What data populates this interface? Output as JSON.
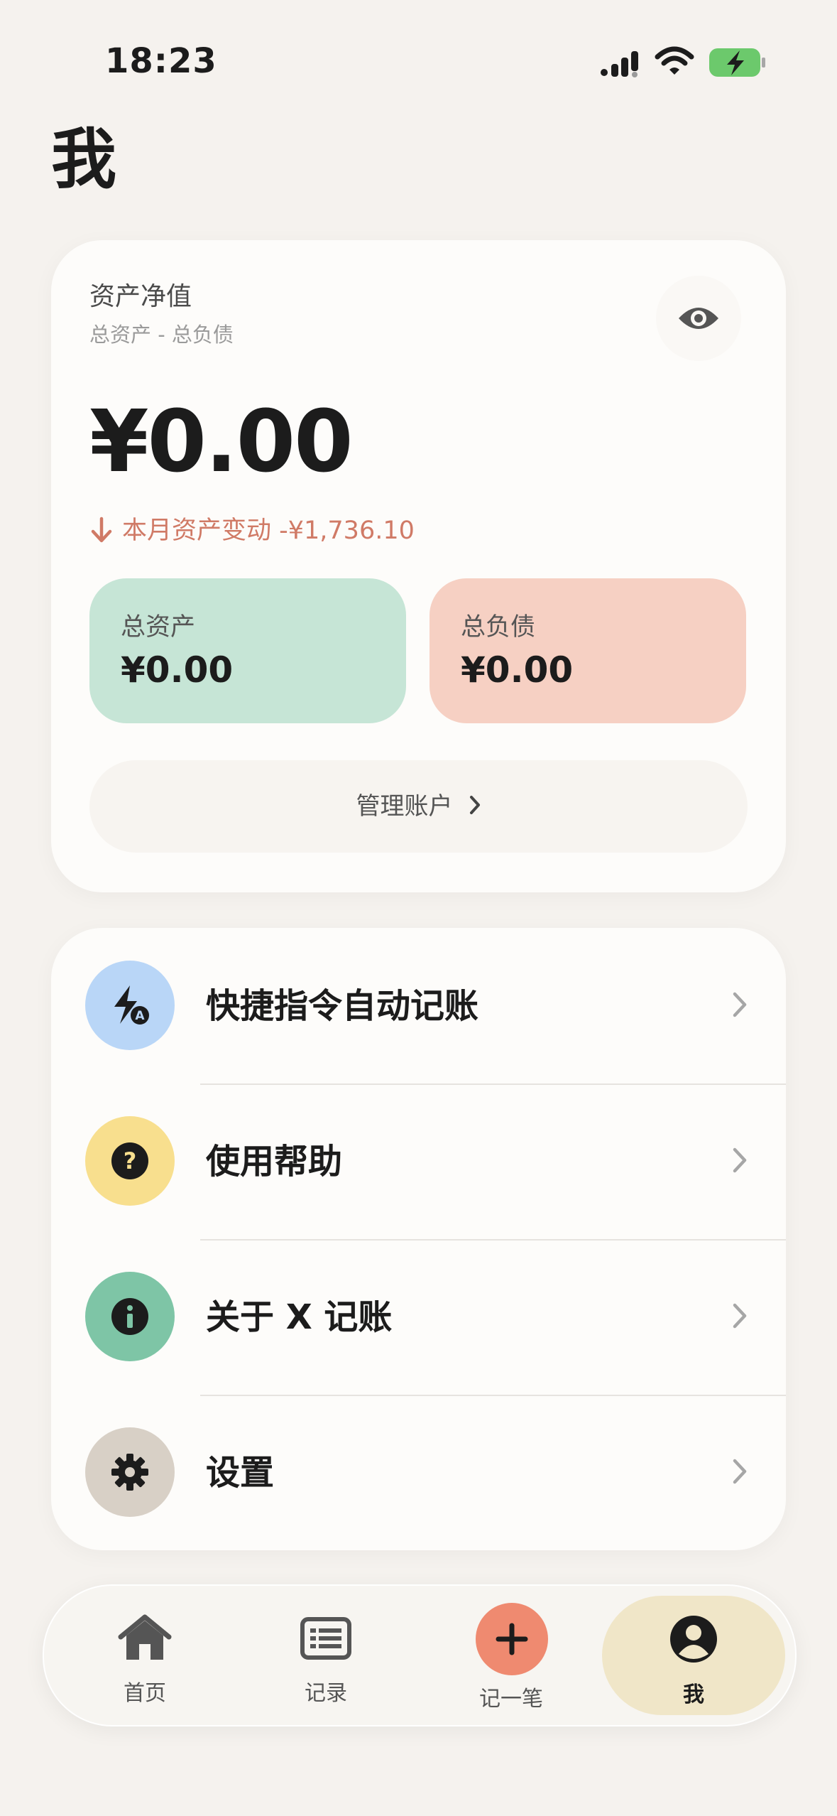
{
  "status_bar": {
    "time": "18:23"
  },
  "page": {
    "title": "我"
  },
  "net_worth": {
    "label": "资产净值",
    "sublabel": "总资产 - 总负债",
    "amount": "¥0.00",
    "change_text": "本月资产变动 -¥1,736.10",
    "assets": {
      "label": "总资产",
      "value": "¥0.00"
    },
    "liabilities": {
      "label": "总负债",
      "value": "¥0.00"
    },
    "manage_label": "管理账户"
  },
  "menu": {
    "items": [
      {
        "label": "快捷指令自动记账",
        "icon": "shortcut-bolt-icon",
        "color": "#b9d6f7"
      },
      {
        "label": "使用帮助",
        "icon": "help-icon",
        "color": "#f8df8e"
      },
      {
        "label": "关于 X 记账",
        "icon": "info-icon",
        "color": "#7ec5a6"
      },
      {
        "label": "设置",
        "icon": "gear-icon",
        "color": "#d8d0c6"
      }
    ]
  },
  "tabs": [
    {
      "label": "首页",
      "icon": "home-icon"
    },
    {
      "label": "记录",
      "icon": "records-icon"
    },
    {
      "label": "记一笔",
      "icon": "plus-icon"
    },
    {
      "label": "我",
      "icon": "profile-icon",
      "active": true
    }
  ],
  "colors": {
    "background": "#f5f2ee",
    "card": "#fdfcfa",
    "negative": "#d07a66",
    "assets_tile": "#c6e5d6",
    "liabilities_tile": "#f6d0c3",
    "add_button": "#ef8a70",
    "active_tab": "#f0e6c8"
  }
}
